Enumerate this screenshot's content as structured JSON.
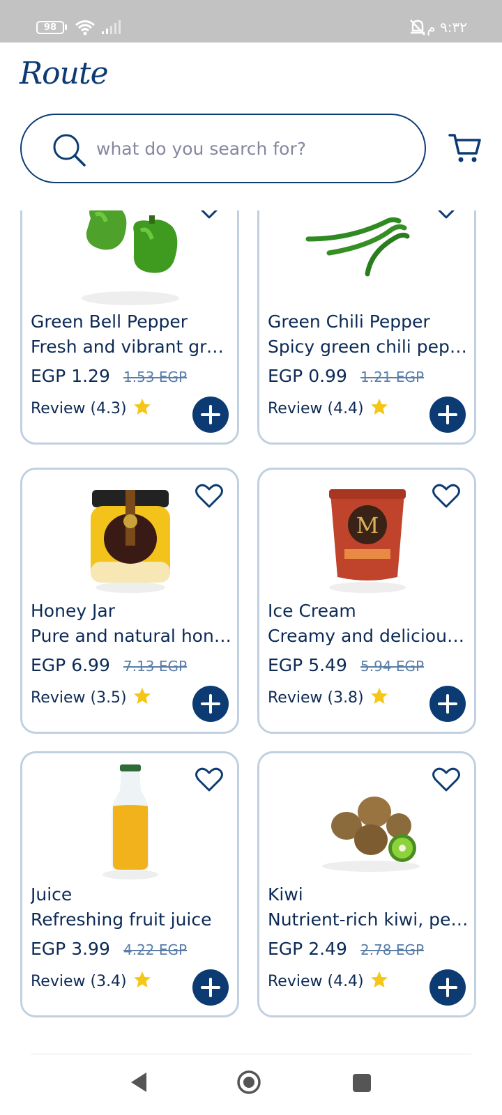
{
  "status_bar": {
    "battery": "98",
    "time": "٩:٣٢ م"
  },
  "header": {
    "logo": "Route",
    "search_placeholder": "what do you search for?"
  },
  "products": [
    {
      "name": "Green Bell Pepper",
      "description": "Fresh and vibrant green bell peppers",
      "price": "EGP 1.29",
      "old_price": "1.53 EGP",
      "review": "Review (4.3)",
      "image": "green-bell-pepper"
    },
    {
      "name": "Green Chili Pepper",
      "description": "Spicy green chili peppers",
      "price": "EGP 0.99",
      "old_price": "1.21 EGP",
      "review": "Review (4.4)",
      "image": "green-chili-pepper"
    },
    {
      "name": "Honey Jar",
      "description": "Pure and natural honey",
      "price": "EGP 6.99",
      "old_price": "7.13 EGP",
      "review": "Review (3.5)",
      "image": "honey-jar"
    },
    {
      "name": "Ice Cream",
      "description": "Creamy and delicious ice cream",
      "price": "EGP 5.49",
      "old_price": "5.94 EGP",
      "review": "Review (3.8)",
      "image": "ice-cream-tub"
    },
    {
      "name": "Juice",
      "description": "Refreshing fruit juice",
      "price": "EGP 3.99",
      "old_price": "4.22 EGP",
      "review": "Review (3.4)",
      "image": "juice-bottle"
    },
    {
      "name": "Kiwi",
      "description": "Nutrient-rich kiwi, perfect for snacking",
      "price": "EGP 2.49",
      "old_price": "2.78 EGP",
      "review": "Review (4.4)",
      "image": "kiwi"
    }
  ],
  "colors": {
    "brand": "#0c3b73",
    "card_border": "#c1d0e0",
    "star": "#f5c518",
    "old_price": "#5a7ea8"
  },
  "icons": [
    "search-icon",
    "cart-icon",
    "heart-icon",
    "star-icon",
    "plus-icon",
    "back-icon",
    "home-icon",
    "recent-apps-icon"
  ]
}
